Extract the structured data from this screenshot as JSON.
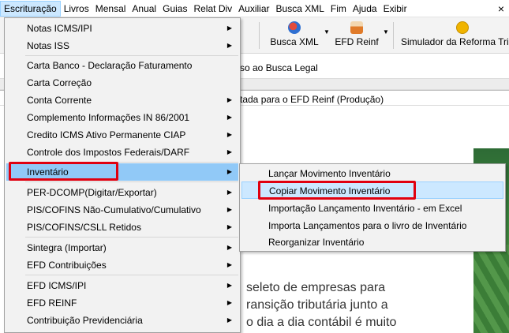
{
  "menubar": {
    "items": [
      "Escrituração",
      "Livros",
      "Mensal",
      "Anual",
      "Guias",
      "Relat Div",
      "Auxiliar",
      "Busca XML",
      "Fim",
      "Ajuda",
      "Exibir"
    ],
    "close": "×"
  },
  "toolbar": {
    "busca_xml": "Busca XML",
    "efd_reinf": "EFD Reinf",
    "simulador": "Simulador da Reforma Tributá",
    "colors": {
      "busca": "#2f6fd1",
      "reinf": "#e07b2a",
      "simulador": "#f0b400"
    }
  },
  "info": {
    "row1": "so ao Busca Legal",
    "row3": "tada para o EFD Reinf (Produção)"
  },
  "content": {
    "lines": [
      "seleto de empresas para",
      "ransição tributária junto a",
      "o dia a dia contábil é muito"
    ]
  },
  "menu_main": {
    "items": [
      {
        "label": "Notas ICMS/IPI",
        "submenu": true
      },
      {
        "label": "Notas ISS",
        "submenu": true
      },
      {
        "label": "Carta Banco - Declaração Faturamento",
        "submenu": false
      },
      {
        "label": "Carta Correção",
        "submenu": false
      },
      {
        "label": "Conta Corrente",
        "submenu": true
      },
      {
        "label": "Complemento Informações IN 86/2001",
        "submenu": true
      },
      {
        "label": "Credito ICMS Ativo Permanente CIAP",
        "submenu": true
      },
      {
        "label": "Controle dos Impostos Federais/DARF",
        "submenu": true
      },
      {
        "label": "Inventário",
        "submenu": true
      },
      {
        "label": "PER-DCOMP(Digitar/Exportar)",
        "submenu": true
      },
      {
        "label": "PIS/COFINS Não-Cumulativo/Cumulativo",
        "submenu": true
      },
      {
        "label": "PIS/COFINS/CSLL Retidos",
        "submenu": true
      },
      {
        "label": "Sintegra (Importar)",
        "submenu": true
      },
      {
        "label": "EFD Contribuições",
        "submenu": true
      },
      {
        "label": "EFD ICMS/IPI",
        "submenu": true
      },
      {
        "label": "EFD REINF",
        "submenu": true
      },
      {
        "label": "Contribuição Previdenciária",
        "submenu": true
      }
    ],
    "arrow": "▶"
  },
  "menu_sub": {
    "items": [
      "Lançar Movimento Inventário",
      "Copiar Movimento Inventário",
      "Importação Lançamento Inventário - em Excel",
      "Importa Lançamentos para o livro de Inventário",
      "Reorganizar Inventário"
    ]
  },
  "highlight_color": "#e0000f"
}
